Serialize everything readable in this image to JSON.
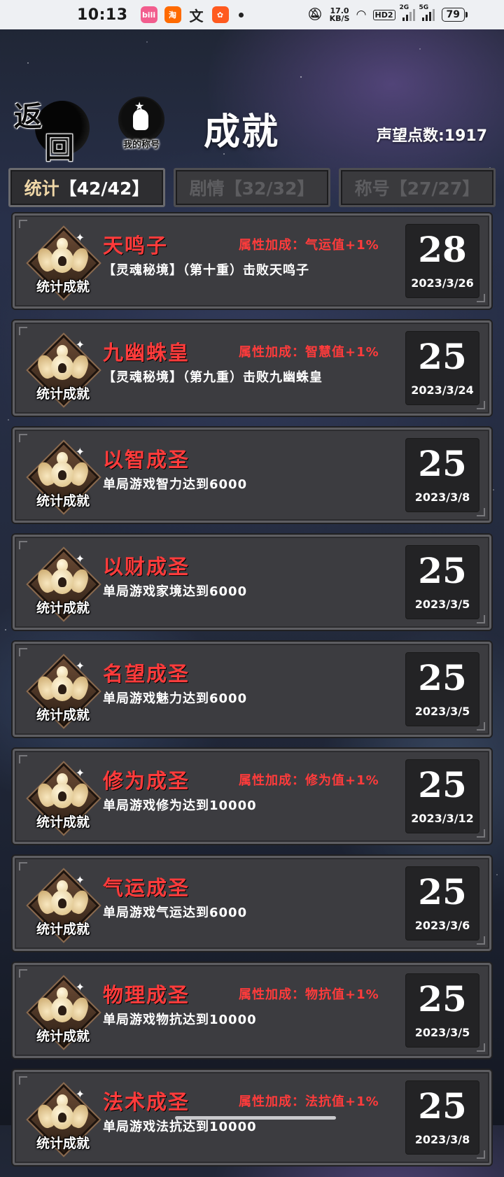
{
  "status_bar": {
    "time": "10:13",
    "app_icons": [
      {
        "name": "bilibili-icon",
        "text": "bili"
      },
      {
        "name": "taobao-icon",
        "text": "淘"
      },
      {
        "name": "wenku-icon",
        "text": "文"
      },
      {
        "name": "app-orange-icon",
        "text": "✿"
      }
    ],
    "net_speed": "17.0",
    "net_unit": "KB/S",
    "hd": "HD2",
    "sim1": "2G",
    "sim2": "5G",
    "battery": "79"
  },
  "header": {
    "back": {
      "char1": "返",
      "char2": "回"
    },
    "title_button_label": "我的称号",
    "title": "成就",
    "fame": "声望点数:1917"
  },
  "tabs": [
    {
      "label": "统计",
      "count": "【42/42】",
      "active": true
    },
    {
      "label": "剧情",
      "count": "【32/32】",
      "active": false
    },
    {
      "label": "称号",
      "count": "【27/27】",
      "active": false
    }
  ],
  "badge_label": "统计成就",
  "achievements": [
    {
      "name": "天鸣子",
      "bonus": "属性加成：气运值+1%",
      "desc": "【灵魂秘境】（第十重）击败天鸣子",
      "score": "28",
      "date": "2023/3/26"
    },
    {
      "name": "九幽蛛皇",
      "bonus": "属性加成：智慧值+1%",
      "desc": "【灵魂秘境】（第九重）击败九幽蛛皇",
      "score": "25",
      "date": "2023/3/24"
    },
    {
      "name": "以智成圣",
      "bonus": "",
      "desc": "单局游戏智力达到6000",
      "score": "25",
      "date": "2023/3/8"
    },
    {
      "name": "以财成圣",
      "bonus": "",
      "desc": "单局游戏家境达到6000",
      "score": "25",
      "date": "2023/3/5"
    },
    {
      "name": "名望成圣",
      "bonus": "",
      "desc": "单局游戏魅力达到6000",
      "score": "25",
      "date": "2023/3/5"
    },
    {
      "name": "修为成圣",
      "bonus": "属性加成：修为值+1%",
      "desc": "单局游戏修为达到10000",
      "score": "25",
      "date": "2023/3/12"
    },
    {
      "name": "气运成圣",
      "bonus": "",
      "desc": "单局游戏气运达到6000",
      "score": "25",
      "date": "2023/3/6"
    },
    {
      "name": "物理成圣",
      "bonus": "属性加成：物抗值+1%",
      "desc": "单局游戏物抗达到10000",
      "score": "25",
      "date": "2023/3/5"
    },
    {
      "name": "法术成圣",
      "bonus": "属性加成：法抗值+1%",
      "desc": "单局游戏法抗达到10000",
      "score": "25",
      "date": "2023/3/8"
    }
  ]
}
